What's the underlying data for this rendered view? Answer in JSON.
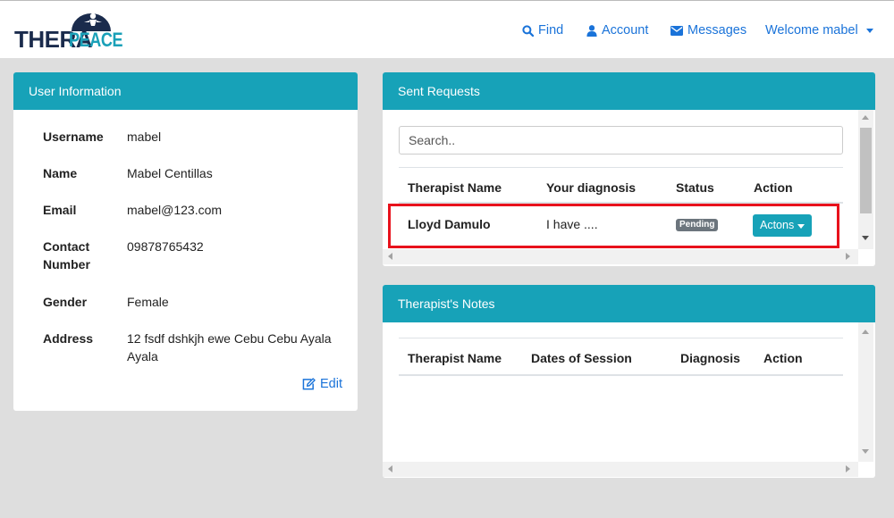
{
  "brand": {
    "part1": "THERA",
    "part2": "PEACE",
    "colors": {
      "navy": "#1a2b4c",
      "teal": "#1aa0b8"
    }
  },
  "nav": {
    "find": "Find",
    "account": "Account",
    "messages": "Messages",
    "welcome": "Welcome mabel"
  },
  "user_info": {
    "title": "User Information",
    "fields": [
      {
        "label": "Username",
        "value": "mabel"
      },
      {
        "label": "Name",
        "value": "Mabel Centillas"
      },
      {
        "label": "Email",
        "value": "mabel@123.com"
      },
      {
        "label": "Contact Number",
        "value": "09878765432"
      },
      {
        "label": "Gender",
        "value": "Female"
      },
      {
        "label": "Address",
        "value": "12 fsdf dshkjh ewe Cebu Cebu Ayala Ayala"
      }
    ],
    "edit_label": "Edit"
  },
  "sent_requests": {
    "title": "Sent Requests",
    "search_placeholder": "Search..",
    "columns": [
      "Therapist Name",
      "Your diagnosis",
      "Status",
      "Action"
    ],
    "rows": [
      {
        "therapist": "Lloyd Damulo",
        "diagnosis": "I have ....",
        "status": "Pending",
        "action": "Actons"
      }
    ]
  },
  "notes": {
    "title": "Therapist's Notes",
    "columns": [
      "Therapist Name",
      "Dates of Session",
      "Diagnosis",
      "Action"
    ]
  },
  "colors": {
    "accent": "#17a2b8",
    "link": "#1a73d9",
    "badge": "#6c757d",
    "highlight": "#e8121c",
    "background": "#dedede"
  }
}
